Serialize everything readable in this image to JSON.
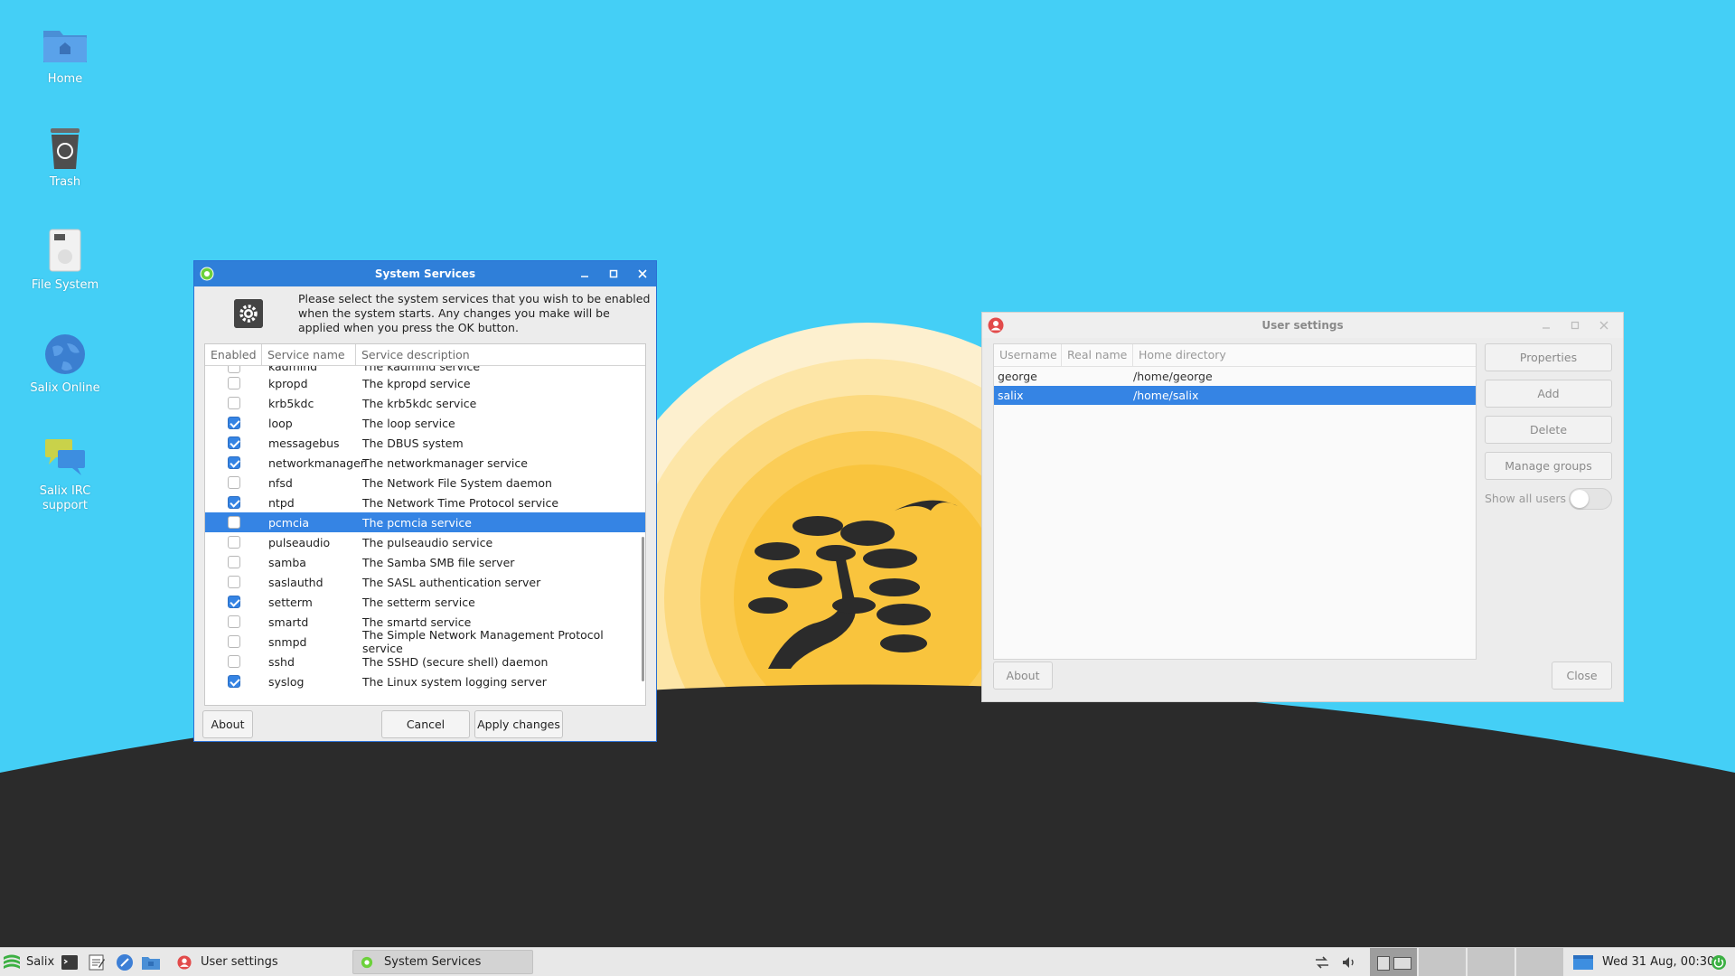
{
  "desktop": {
    "icons": [
      {
        "label": "Home",
        "icon": "home-folder-icon"
      },
      {
        "label": "Trash",
        "icon": "trash-icon"
      },
      {
        "label": "File System",
        "icon": "drive-icon"
      },
      {
        "label": "Salix Online",
        "icon": "globe-icon"
      },
      {
        "label": "Salix IRC support",
        "icon": "chat-icon"
      }
    ]
  },
  "system_services": {
    "title": "System Services",
    "description": "Please select the system services that you wish to be enabled when the system starts. Any changes you make will be applied when you press the OK button.",
    "columns": {
      "enabled": "Enabled",
      "name": "Service name",
      "desc": "Service description"
    },
    "partial_row": {
      "name": "kadmind",
      "desc": "The kadmind service"
    },
    "rows": [
      {
        "name": "kpropd",
        "desc": "The kpropd service",
        "enabled": false
      },
      {
        "name": "krb5kdc",
        "desc": "The krb5kdc service",
        "enabled": false
      },
      {
        "name": "loop",
        "desc": "The loop service",
        "enabled": true
      },
      {
        "name": "messagebus",
        "desc": "The DBUS system",
        "enabled": true
      },
      {
        "name": "networkmanager",
        "desc": "The networkmanager service",
        "enabled": true
      },
      {
        "name": "nfsd",
        "desc": "The Network File System daemon",
        "enabled": false
      },
      {
        "name": "ntpd",
        "desc": "The Network Time Protocol service",
        "enabled": true
      },
      {
        "name": "pcmcia",
        "desc": "The pcmcia service",
        "enabled": false,
        "selected": true
      },
      {
        "name": "pulseaudio",
        "desc": "The pulseaudio service",
        "enabled": false
      },
      {
        "name": "samba",
        "desc": "The Samba SMB file server",
        "enabled": false
      },
      {
        "name": "saslauthd",
        "desc": "The SASL authentication server",
        "enabled": false
      },
      {
        "name": "setterm",
        "desc": "The setterm service",
        "enabled": true
      },
      {
        "name": "smartd",
        "desc": "The smartd service",
        "enabled": false
      },
      {
        "name": "snmpd",
        "desc": "The Simple Network Management Protocol service",
        "enabled": false
      },
      {
        "name": "sshd",
        "desc": "The SSHD (secure shell) daemon",
        "enabled": false
      },
      {
        "name": "syslog",
        "desc": "The Linux system logging server",
        "enabled": true
      }
    ],
    "buttons": {
      "about": "About",
      "cancel": "Cancel",
      "apply": "Apply changes"
    }
  },
  "user_settings": {
    "title": "User settings",
    "columns": {
      "username": "Username",
      "realname": "Real name",
      "home": "Home directory"
    },
    "users": [
      {
        "username": "george",
        "realname": "",
        "home": "/home/george",
        "selected": false
      },
      {
        "username": "salix",
        "realname": "",
        "home": "/home/salix",
        "selected": true
      }
    ],
    "buttons": {
      "properties": "Properties",
      "add": "Add",
      "delete": "Delete",
      "manage_groups": "Manage groups",
      "about": "About",
      "close": "Close"
    },
    "show_all_users": {
      "label": "Show all users",
      "on": false
    }
  },
  "taskbar": {
    "menu_label": "Salix",
    "tasks": [
      {
        "label": "User settings",
        "active": false
      },
      {
        "label": "System Services",
        "active": true
      }
    ],
    "clock": "Wed 31 Aug, 00:30"
  },
  "colors": {
    "accent": "#3584e4",
    "titlebar": "#2f7fd9",
    "sky": "#44cff6",
    "ground": "#2b2b2b"
  }
}
